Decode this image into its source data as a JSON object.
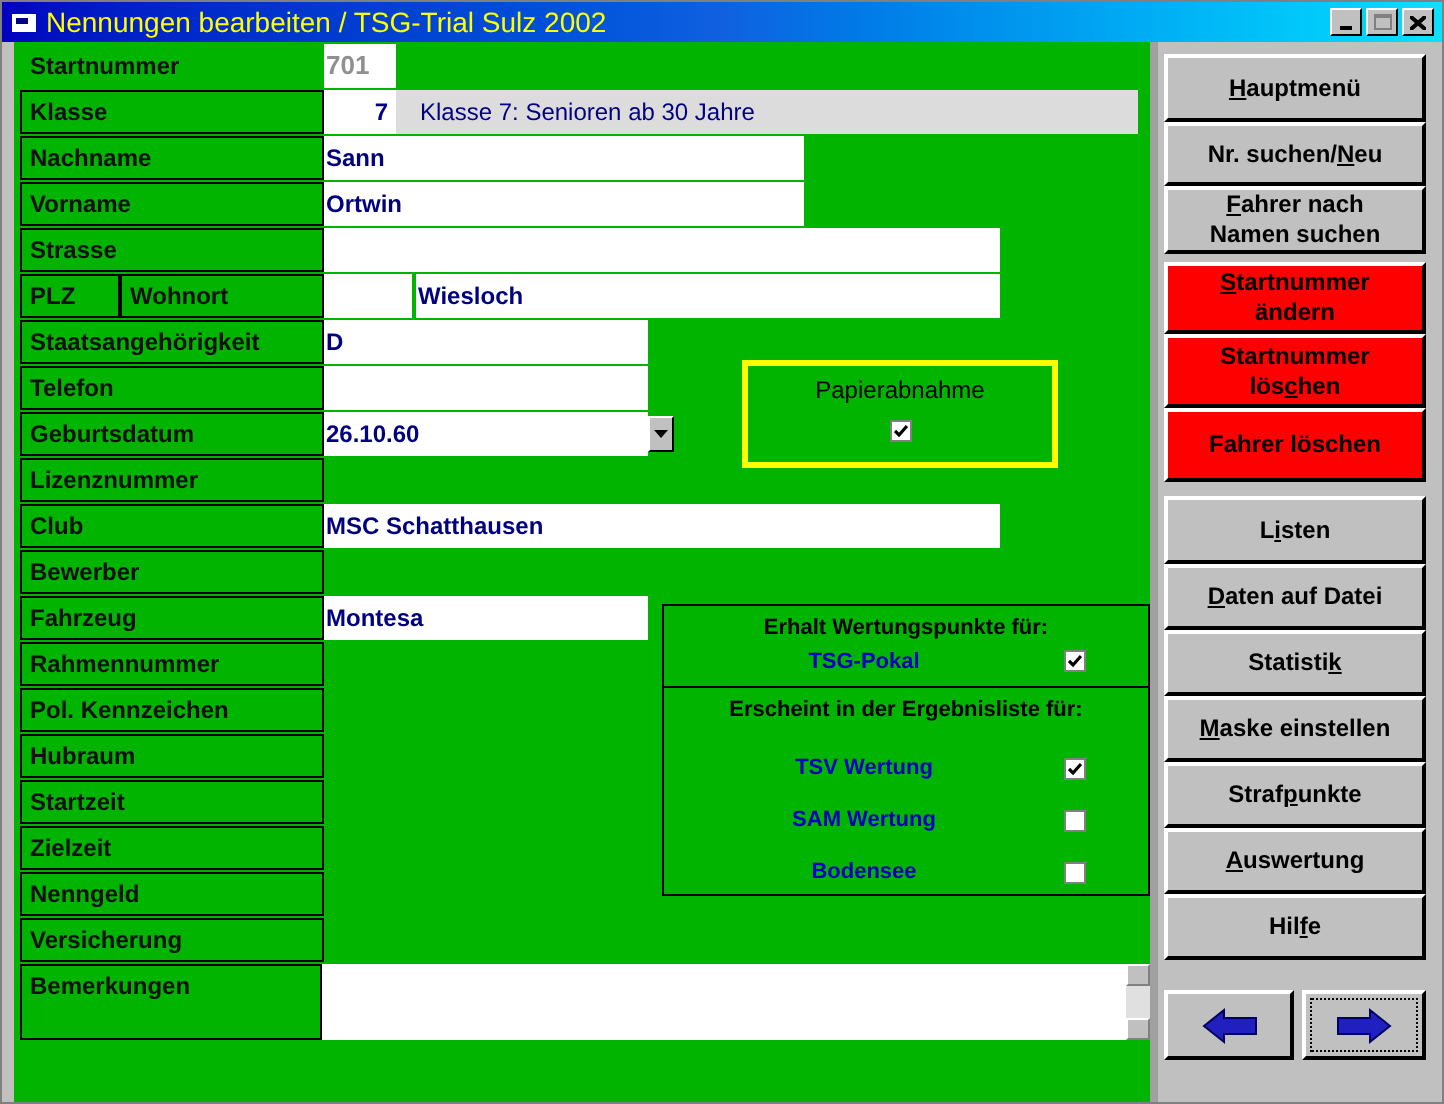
{
  "window": {
    "title": "Nennungen bearbeiten / TSG-Trial Sulz 2002"
  },
  "fields": [
    {
      "kind": "startnummer",
      "label": "Startnummer",
      "value": "701",
      "disabled": true
    },
    {
      "kind": "klasse",
      "label": "Klasse",
      "value": "7",
      "description": "Klasse 7: Senioren ab 30 Jahre"
    },
    {
      "kind": "field",
      "label": "Nachname",
      "value": "Sann"
    },
    {
      "kind": "field",
      "label": "Vorname",
      "value": "Ortwin"
    },
    {
      "kind": "field",
      "label": "Strasse"
    },
    {
      "kind": "plz",
      "label": "PLZ",
      "label_2": "Wohnort",
      "value_2": "Wiesloch"
    },
    {
      "kind": "field",
      "label": "Staatsangehörigkeit",
      "value": "D"
    },
    {
      "kind": "field",
      "label": "Telefon"
    },
    {
      "kind": "date",
      "label": "Geburtsdatum",
      "value": "26.10.60"
    },
    {
      "kind": "none",
      "label": "Lizenznummer"
    },
    {
      "kind": "field",
      "label": "Club",
      "value": "MSC Schatthausen"
    },
    {
      "kind": "none",
      "label": "Bewerber"
    },
    {
      "kind": "field",
      "label": "Fahrzeug",
      "value": "Montesa"
    },
    {
      "kind": "none",
      "label": "Rahmennummer"
    },
    {
      "kind": "none",
      "label": "Pol. Kennzeichen"
    },
    {
      "kind": "none",
      "label": "Hubraum"
    },
    {
      "kind": "none",
      "label": "Startzeit"
    },
    {
      "kind": "none",
      "label": "Zielzeit"
    },
    {
      "kind": "none",
      "label": "Nenngeld"
    },
    {
      "kind": "none",
      "label": "Versicherung"
    },
    {
      "kind": "memo",
      "label": "Bemerkungen"
    }
  ],
  "papierabnahme": {
    "label": "Papierabnahme",
    "checked": true
  },
  "wertung": {
    "points_heading": "Erhalt Wertungspunkte für:",
    "points": [
      {
        "label": "TSG-Pokal",
        "checked": true
      }
    ],
    "list_heading": "Erscheint in der Ergebnisliste für:",
    "lists": [
      {
        "label": "TSV Wertung",
        "checked": true
      },
      {
        "label": "SAM Wertung",
        "checked": false
      },
      {
        "label": "Bodensee",
        "checked": false
      }
    ]
  },
  "buttons": [
    {
      "kind": "normal",
      "label": {
        "key": "H",
        "after": "auptmenü"
      }
    },
    {
      "kind": "normal",
      "label": {
        "before": "Nr. suchen/",
        "key": "N",
        "after": "eu"
      }
    },
    {
      "kind": "normal",
      "label": {
        "key": "F",
        "after": "ahrer nach\nNamen suchen"
      }
    },
    {
      "kind": "danger",
      "label": {
        "key": "S",
        "after": "tartnummer\nändern"
      }
    },
    {
      "kind": "danger",
      "label": {
        "before": "Startnummer\nlös",
        "key": "c",
        "after": "hen"
      }
    },
    {
      "kind": "danger",
      "label": {
        "before": "Fahrer löschen"
      }
    },
    {
      "kind": "normal",
      "label": {
        "before": "L",
        "key": "i",
        "after": "sten"
      }
    },
    {
      "kind": "normal",
      "label": {
        "key": "D",
        "after": "aten auf Datei"
      }
    },
    {
      "kind": "normal",
      "label": {
        "before": "Statisti",
        "key": "k"
      }
    },
    {
      "kind": "normal",
      "label": {
        "key": "M",
        "after": "aske einstellen"
      }
    },
    {
      "kind": "normal",
      "label": {
        "before": "Straf",
        "key": "p",
        "after": "unkte"
      }
    },
    {
      "kind": "normal",
      "label": {
        "key": "A",
        "after": "uswertung"
      }
    },
    {
      "kind": "normal",
      "label": {
        "before": "Hil",
        "key": "f",
        "after": "e"
      }
    }
  ]
}
